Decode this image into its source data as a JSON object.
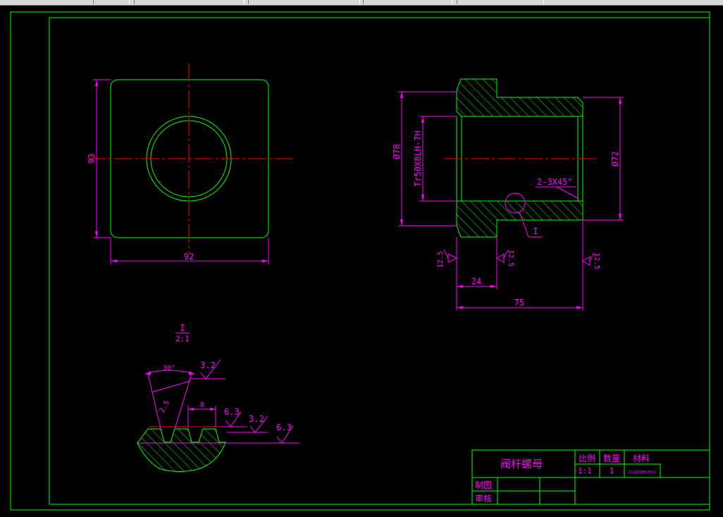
{
  "colors": {
    "background": "#000000",
    "border": "#00ff00",
    "part_outline": "#00ff00",
    "dimension": "#ff00ff",
    "centerline": "#ff0000",
    "hatch": "#00ff00"
  },
  "dimensions": {
    "side_height": "93",
    "width": "92",
    "outer_dia": "Ø78",
    "thread": "Tr50X8LH-7H",
    "flange_dia": "Ø72",
    "chamfer": "2-3X45°",
    "detail_ref": "I",
    "rough_left": "12.5",
    "rough_mid": "12.5",
    "rough_right": "12.5",
    "length_small": "24",
    "length_total": "75"
  },
  "detail": {
    "ref": "I",
    "scale": "2:1",
    "angle": "30°",
    "pitch_half": "2.5",
    "width": "8",
    "rough_a": "3.2",
    "rough_b": "6.3",
    "rough_c": "3.2",
    "rough_d": "6.3"
  },
  "title_block": {
    "part_name": "阀杆螺母",
    "scale_label": "比例",
    "qty_label": "数量",
    "material_label": "材料",
    "scale_value": "1:1",
    "qty_value": "1",
    "material_value": "ZCuZn38Mn2Pb2",
    "drawn_label": "制图",
    "checked_label": "审核"
  }
}
